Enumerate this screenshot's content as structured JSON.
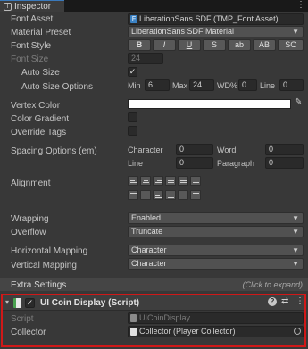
{
  "window": {
    "tab_title": "Inspector",
    "tab_icon": "info-icon",
    "menu_icon": "kebab-menu-icon"
  },
  "font_asset": {
    "label": "Font Asset",
    "value": "LiberationSans SDF (TMP_Font Asset)",
    "icon": "font-asset-icon"
  },
  "material_preset": {
    "label": "Material Preset",
    "value": "LiberationSans SDF Material"
  },
  "font_style": {
    "label": "Font Style",
    "buttons": [
      "B",
      "I",
      "U",
      "S",
      "ab",
      "AB",
      "SC"
    ]
  },
  "font_size": {
    "label": "Font Size",
    "value": "24"
  },
  "auto_size": {
    "label": "Auto Size",
    "checked": "✓"
  },
  "auto_size_options": {
    "label": "Auto Size Options",
    "min_label": "Min",
    "min_value": "6",
    "max_label": "Max",
    "max_value": "24",
    "wd_label": "WD%",
    "wd_value": "0",
    "line_label": "Line",
    "line_value": "0"
  },
  "vertex_color": {
    "label": "Vertex Color",
    "color": "#ffffff",
    "picker_icon": "eyedropper-icon"
  },
  "color_gradient": {
    "label": "Color Gradient"
  },
  "override_tags": {
    "label": "Override Tags"
  },
  "spacing": {
    "label": "Spacing Options (em)",
    "character_label": "Character",
    "character_value": "0",
    "word_label": "Word",
    "word_value": "0",
    "line_label": "Line",
    "line_value": "0",
    "paragraph_label": "Paragraph",
    "paragraph_value": "0"
  },
  "alignment": {
    "label": "Alignment"
  },
  "wrapping": {
    "label": "Wrapping",
    "value": "Enabled"
  },
  "overflow": {
    "label": "Overflow",
    "value": "Truncate"
  },
  "horizontal_mapping": {
    "label": "Horizontal Mapping",
    "value": "Character"
  },
  "vertical_mapping": {
    "label": "Vertical Mapping",
    "value": "Character"
  },
  "extra_settings": {
    "label": "Extra Settings",
    "hint": "(Click to expand)"
  },
  "component": {
    "title": "UI Coin Display (Script)",
    "enabled": "✓",
    "script_label": "Script",
    "script_value": "UICoinDisplay",
    "collector_label": "Collector",
    "collector_value": "Collector (Player Collector)",
    "help_icon": "?",
    "settings_icon": "⇄",
    "menu_icon": "⋮"
  },
  "colors": {
    "highlight": "#d01818",
    "panel": "#383838",
    "field": "#2a2a2a"
  }
}
